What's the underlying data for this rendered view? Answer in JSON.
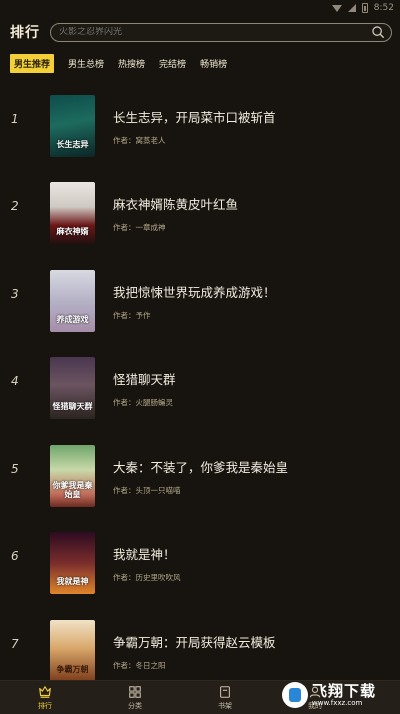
{
  "status_bar": {
    "time": "8:52"
  },
  "header": {
    "title": "排行",
    "search_placeholder": "火影之忍界闪光"
  },
  "tabs": [
    {
      "label": "男生推荐",
      "active": true
    },
    {
      "label": "男生总榜",
      "active": false
    },
    {
      "label": "热搜榜",
      "active": false
    },
    {
      "label": "完结榜",
      "active": false
    },
    {
      "label": "畅销榜",
      "active": false
    }
  ],
  "books": [
    {
      "rank": "1",
      "title": "长生志异，开局菜市口被斩首",
      "author": "作者：窝蒸老人",
      "cover_text": "长生志异",
      "cover_color": "#1d6b5e"
    },
    {
      "rank": "2",
      "title": "麻衣神婿陈黄皮叶红鱼",
      "author": "作者：一章成神",
      "cover_text": "麻衣神婿",
      "cover_color": "#6b1616"
    },
    {
      "rank": "3",
      "title": "我把惊悚世界玩成养成游戏！",
      "author": "作者：予作",
      "cover_text": "养成游戏",
      "cover_color": "#b5b2c6"
    },
    {
      "rank": "4",
      "title": "怪猎聊天群",
      "author": "作者：火腿肠蝙灵",
      "cover_text": "怪猎聊天群",
      "cover_color": "#4a3750"
    },
    {
      "rank": "5",
      "title": "大秦：不装了，你爹我是秦始皇",
      "author": "作者：头顶一只喵喵",
      "cover_text": "你爹我是秦始皇",
      "cover_color": "#c06b5a"
    },
    {
      "rank": "6",
      "title": "我就是神！",
      "author": "作者：历史里吹吹风",
      "cover_text": "我就是神",
      "cover_color": "#7a2d2c"
    },
    {
      "rank": "7",
      "title": "争霸万朝：开局获得赵云模板",
      "author": "作者：冬日之阳",
      "cover_text": "争霸万朝",
      "cover_color": "#d9a86b"
    }
  ],
  "bottom_nav": [
    {
      "label": "排行",
      "icon": "rank-icon",
      "active": true
    },
    {
      "label": "分类",
      "icon": "grid-icon",
      "active": false
    },
    {
      "label": "书架",
      "icon": "bookshelf-icon",
      "active": false
    },
    {
      "label": "我的",
      "icon": "profile-icon",
      "active": false
    }
  ],
  "watermark": {
    "brand": "飞翔下载",
    "url": "www.fxxz.com"
  },
  "colors": {
    "accent": "#f3d037",
    "background": "#17130e"
  }
}
